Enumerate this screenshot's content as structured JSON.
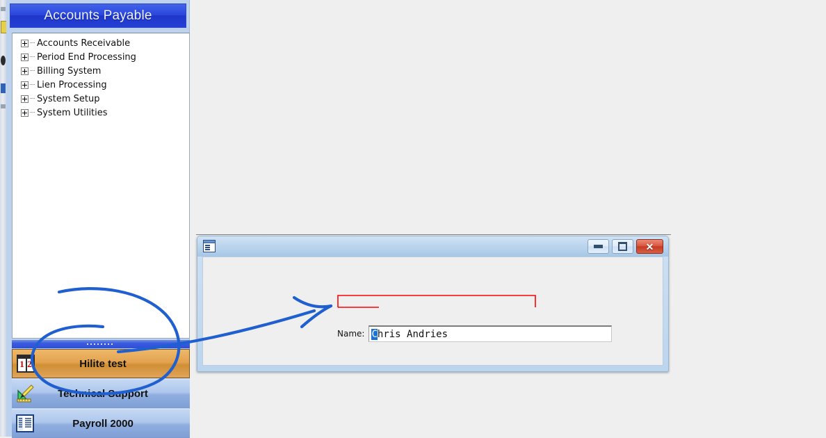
{
  "app": {
    "background_color": "#efefef"
  },
  "sidebar": {
    "header": {
      "title": "Accounts Payable",
      "bg_color": "#2a46dd"
    },
    "tree": {
      "items": [
        {
          "label": "Accounts Receivable",
          "expander": "plus-icon"
        },
        {
          "label": "Period End Processing",
          "expander": "plus-icon"
        },
        {
          "label": "Billing System",
          "expander": "plus-icon"
        },
        {
          "label": "Lien Processing",
          "expander": "plus-icon"
        },
        {
          "label": "System Setup",
          "expander": "plus-icon"
        },
        {
          "label": "System Utilities",
          "expander": "plus-icon"
        }
      ]
    },
    "splitter": {
      "grip": "dotted-grip"
    },
    "nav_buttons": [
      {
        "label": "Hilite test",
        "icon": "counter-1-2-icon",
        "selected": true,
        "accent_color": "#d08f35"
      },
      {
        "label": "Technical Support",
        "icon": "drafting-tools-icon",
        "selected": false,
        "accent_color": "#90aedf"
      },
      {
        "label": "Payroll 2000",
        "icon": "list-document-icon",
        "selected": false,
        "accent_color": "#90aedf"
      }
    ]
  },
  "dialog": {
    "title": "",
    "window_icon": "form-window-icon",
    "controls": {
      "minimize": {
        "icon": "minimize-icon",
        "label": ""
      },
      "maximize": {
        "icon": "maximize-icon",
        "label": ""
      },
      "close": {
        "icon": "close-icon",
        "label": "✕",
        "color": "#c43a22"
      }
    },
    "form": {
      "name_label": "Name:",
      "name_value_selected": "C",
      "name_value_rest": "hris Andries",
      "name_value": "Chris Andries",
      "name_placeholder": ""
    }
  },
  "annotations": {
    "highlight_box_color": "#ff0000",
    "ink_color": "#1f5fd0",
    "shapes": [
      {
        "kind": "rectangle",
        "name": "red-highlight-box",
        "color": "#ff0000"
      },
      {
        "kind": "ellipse",
        "name": "blue-ink-ellipse",
        "color": "#1f5fd0"
      },
      {
        "kind": "arrow",
        "name": "blue-ink-arrow",
        "color": "#1f5fd0"
      }
    ]
  }
}
